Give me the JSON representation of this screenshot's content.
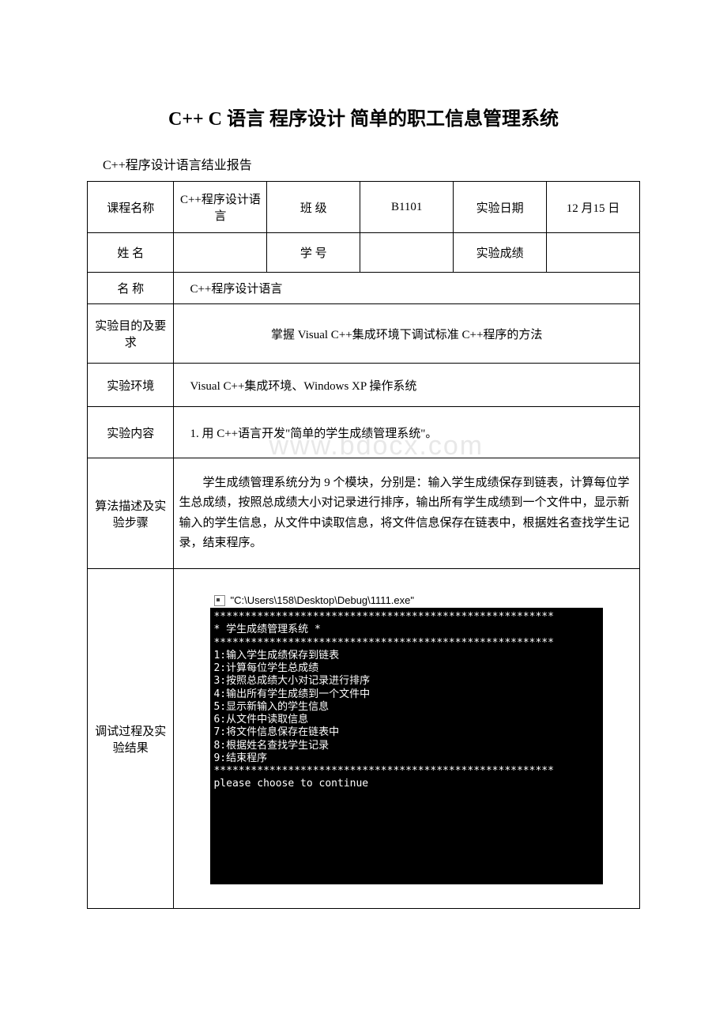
{
  "title": "C++ C 语言 程序设计 简单的职工信息管理系统",
  "subtitle": "C++程序设计语言结业报告",
  "watermark": "www.bdocx.com",
  "table": {
    "row1": {
      "label1": "课程名称",
      "value1": "C++程序设计语言",
      "label2": "班 级",
      "value2": "B1101",
      "label3": "实验日期",
      "value3": "12 月15 日"
    },
    "row2": {
      "label1": "姓 名",
      "value1": "",
      "label2": "学 号",
      "value2": "",
      "label3": "实验成绩",
      "value3": ""
    },
    "row3": {
      "label": "名 称",
      "value": "C++程序设计语言"
    },
    "row4": {
      "label": "实验目的及要求",
      "value": "掌握 Visual C++集成环境下调试标准 C++程序的方法"
    },
    "row5": {
      "label": "实验环境",
      "value": "Visual C++集成环境、Windows XP 操作系统"
    },
    "row6": {
      "label": "实验内容",
      "value": "1. 用 C++语言开发\"简单的学生成绩管理系统\"。"
    },
    "row7": {
      "label": "算法描述及实验步骤",
      "value": "学生成绩管理系统分为 9 个模块，分别是：输入学生成绩保存到链表，计算每位学生总成绩，按照总成绩大小对记录进行排序，输出所有学生成绩到一个文件中，显示新输入的学生信息，从文件中读取信息，将文件信息保存在链表中，根据姓名查找学生记录，结束程序。"
    },
    "row8": {
      "label": "调试过程及实验结果"
    }
  },
  "console": {
    "title": "\"C:\\Users\\158\\Desktop\\Debug\\1111.exe\"",
    "lines": [
      "*******************************************************",
      "* 学生成绩管理系统 *",
      "*******************************************************",
      "1:输入学生成绩保存到链表",
      "2:计算每位学生总成绩",
      "3:按照总成绩大小对记录进行排序",
      "4:输出所有学生成绩到一个文件中",
      "5:显示新输入的学生信息",
      "6:从文件中读取信息",
      "7:将文件信息保存在链表中",
      "8:根据姓名查找学生记录",
      "9:结束程序",
      "*******************************************************",
      "please choose to continue"
    ]
  }
}
